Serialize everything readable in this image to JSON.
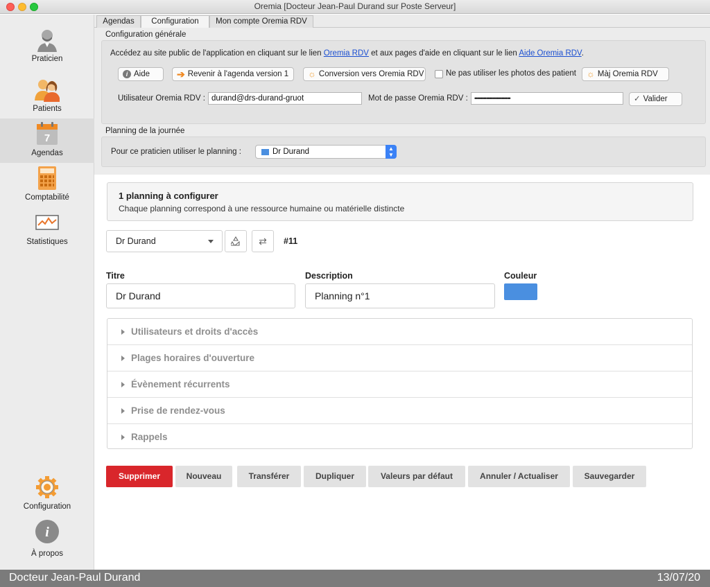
{
  "window": {
    "title": "Oremia [Docteur Jean-Paul Durand sur Poste Serveur]"
  },
  "sidebar": {
    "items": [
      {
        "label": "Praticien",
        "icon": "doctor-icon"
      },
      {
        "label": "Patients",
        "icon": "patients-icon"
      },
      {
        "label": "Agendas",
        "icon": "calendar-icon",
        "badge": "7",
        "active": true
      },
      {
        "label": "Comptabilité",
        "icon": "calculator-icon"
      },
      {
        "label": "Statistiques",
        "icon": "chart-icon"
      }
    ],
    "bottom": [
      {
        "label": "Configuration",
        "icon": "gear-icon"
      },
      {
        "label": "À propos",
        "icon": "info-icon",
        "glyph": "i"
      }
    ]
  },
  "tabs": [
    {
      "label": "Agendas"
    },
    {
      "label": "Configuration",
      "active": true
    },
    {
      "label": "Mon compte Oremia RDV"
    }
  ],
  "config_general": {
    "title": "Configuration générale",
    "info": {
      "part1": "Accédez au site public de l'application en cliquant sur le lien ",
      "link1": "Oremia RDV",
      "part2": " et aux pages d'aide en cliquant sur le lien ",
      "link2": "Aide Oremia RDV",
      "part3": "."
    },
    "buttons": {
      "aide": "Aide",
      "revenir": "Revenir à l'agenda version 1",
      "conversion": "Conversion vers Oremia RDV",
      "no_photos": "Ne pas utiliser les photos des patient",
      "maj": "Màj Oremia RDV"
    },
    "user_label": "Utilisateur Oremia RDV :",
    "user_value": "durand@drs-durand-gruot",
    "password_label": "Mot de passe Oremia RDV :",
    "password_value": "••••••••••••••••••••••••",
    "validate": "Valider"
  },
  "planning_day": {
    "title": "Planning de la journée",
    "label": "Pour ce praticien utiliser le planning :",
    "selected": "Dr Durand",
    "selected_color": "#4a8fe0"
  },
  "main": {
    "banner_title": "1 planning à configurer",
    "banner_subtitle": "Chaque planning correspond à une ressource humaine ou matérielle distincte",
    "planning_select": "Dr Durand",
    "planning_id": "#11",
    "titre_label": "Titre",
    "titre_value": "Dr Durand",
    "description_label": "Description",
    "description_value": "Planning n°1",
    "couleur_label": "Couleur",
    "couleur_value": "#4a8fe0",
    "sections": [
      "Utilisateurs et droits d'accès",
      "Plages horaires d'ouverture",
      "Évènement récurrents",
      "Prise de rendez-vous",
      "Rappels"
    ],
    "actions": {
      "supprimer": "Supprimer",
      "nouveau": "Nouveau",
      "transferer": "Transférer",
      "dupliquer": "Dupliquer",
      "valeurs": "Valeurs par défaut",
      "annuler": "Annuler / Actualiser",
      "sauvegarder": "Sauvegarder"
    }
  },
  "status": {
    "user": "Docteur Jean-Paul Durand",
    "date": "13/07/20"
  },
  "colors": {
    "danger": "#d9262b",
    "accent": "#3b82f6",
    "link": "#1b4fd1"
  }
}
